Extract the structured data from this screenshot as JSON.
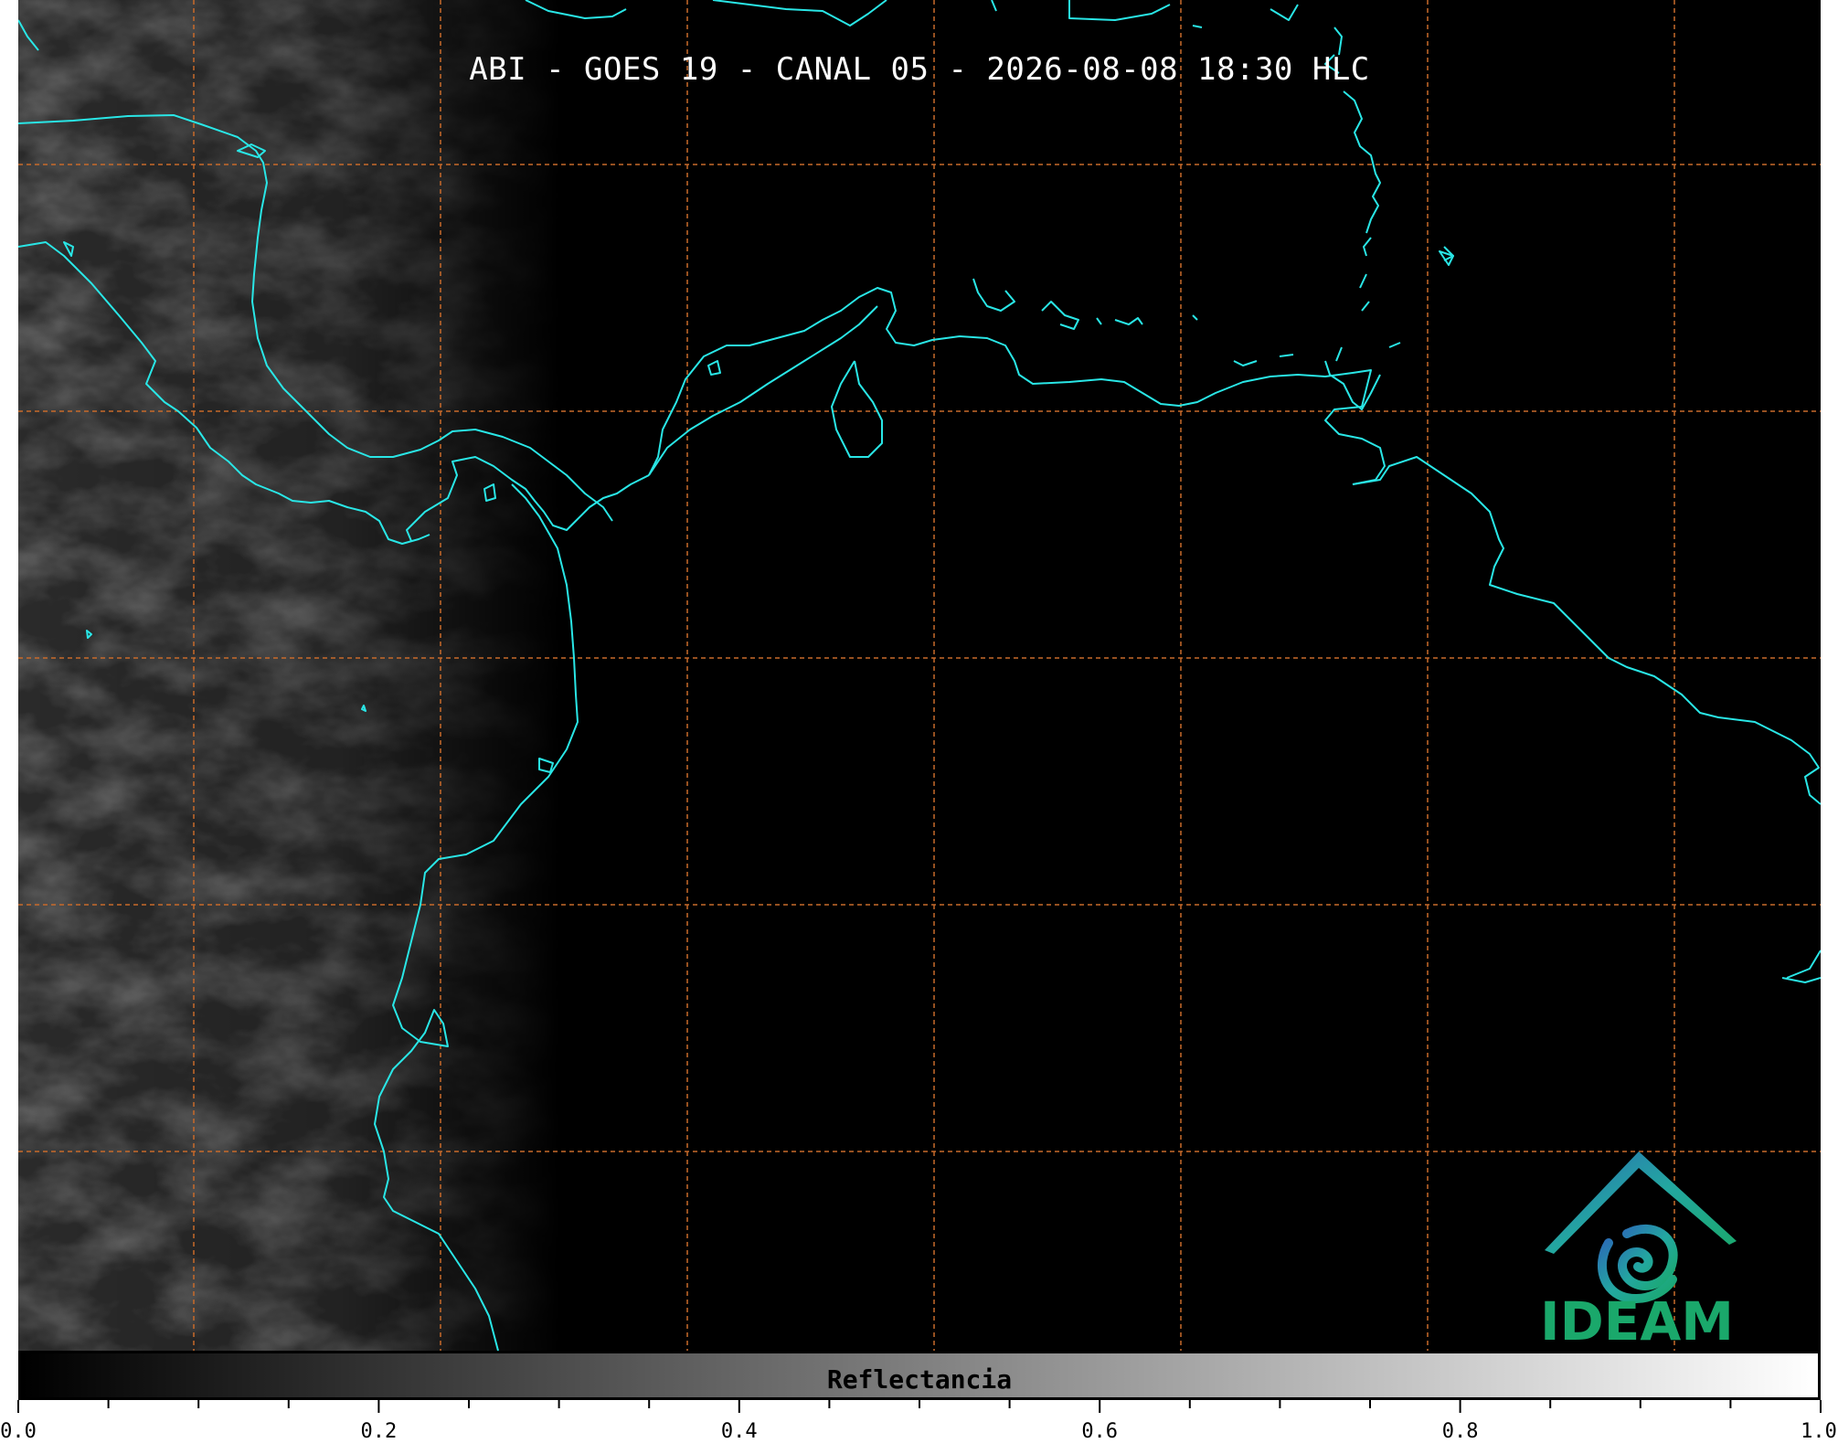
{
  "title": "ABI - GOES 19 - CANAL 05 - 2026-08-08 18:30 HLC",
  "map": {
    "background_color": "#000000",
    "coastline_color": "#29e6e6",
    "gridline_color": "#c86a2a",
    "gridline_style": "dashed",
    "grid_columns": 7,
    "grid_rows": 5,
    "cloud_texture": "grayscale reflectance clouds over western land region"
  },
  "logo": {
    "text": "IDEAM",
    "text_color": "#1aa86b",
    "colors": [
      "#2a6fb5",
      "#23a7a0",
      "#1aa86b"
    ]
  },
  "colorbar": {
    "label": "Reflectancia",
    "colormap": "grayscale",
    "min": 0.0,
    "max": 1.0,
    "tick_labels": [
      "0.0",
      "0.2",
      "0.4",
      "0.6",
      "0.8",
      "1.0"
    ],
    "tick_values": [
      0.0,
      0.2,
      0.4,
      0.6,
      0.8,
      1.0
    ],
    "minor_tick_step": 0.05
  }
}
